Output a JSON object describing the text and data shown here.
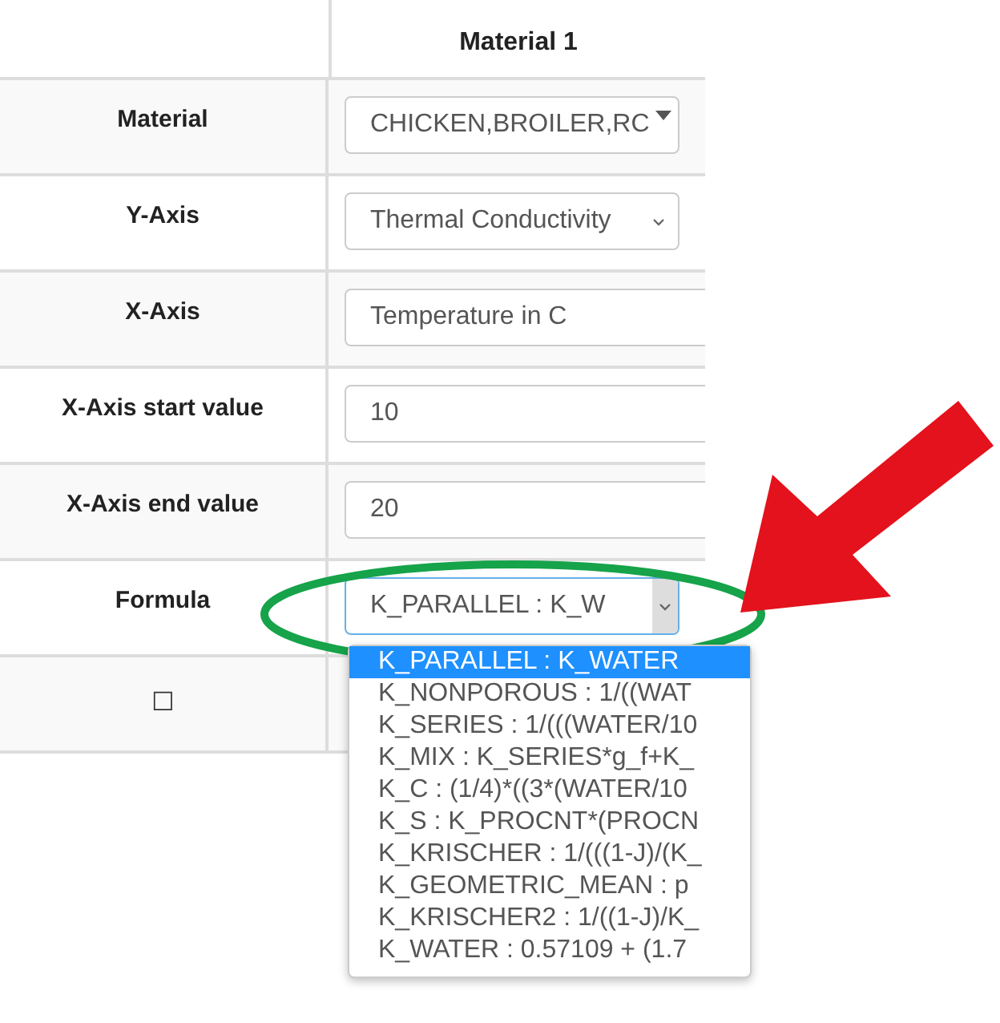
{
  "table": {
    "columns": [
      "Material 1"
    ],
    "rows": [
      {
        "label": "Material",
        "kind": "combo",
        "value": "CHICKEN,BROILER,RC"
      },
      {
        "label": "Y-Axis",
        "kind": "select",
        "value": "Thermal Conductivity"
      },
      {
        "label": "X-Axis",
        "kind": "input",
        "value": "Temperature in C"
      },
      {
        "label": "X-Axis start value",
        "kind": "input",
        "value": "10"
      },
      {
        "label": "X-Axis end value",
        "kind": "input",
        "value": "20"
      },
      {
        "label": "Formula",
        "kind": "dropdown",
        "value": "K_PARALLEL : K_W"
      },
      {
        "label": "☐",
        "kind": "checkbox",
        "checked": false
      }
    ]
  },
  "formula_options": [
    {
      "label": "K_PARALLEL : K_WATER",
      "selected": true
    },
    {
      "label": "K_NONPOROUS : 1/((WAT",
      "selected": false
    },
    {
      "label": "K_SERIES : 1/(((WATER/10",
      "selected": false
    },
    {
      "label": "K_MIX : K_SERIES*g_f+K_",
      "selected": false
    },
    {
      "label": "K_C : (1/4)*((3*(WATER/10",
      "selected": false
    },
    {
      "label": "K_S : K_PROCNT*(PROCN",
      "selected": false
    },
    {
      "label": "K_KRISCHER : 1/(((1-J)/(K_",
      "selected": false
    },
    {
      "label": "K_GEOMETRIC_MEAN : p",
      "selected": false
    },
    {
      "label": "K_KRISCHER2 : 1/((1-J)/K_",
      "selected": false
    },
    {
      "label": "K_WATER : 0.57109 + (1.7",
      "selected": false
    }
  ]
}
